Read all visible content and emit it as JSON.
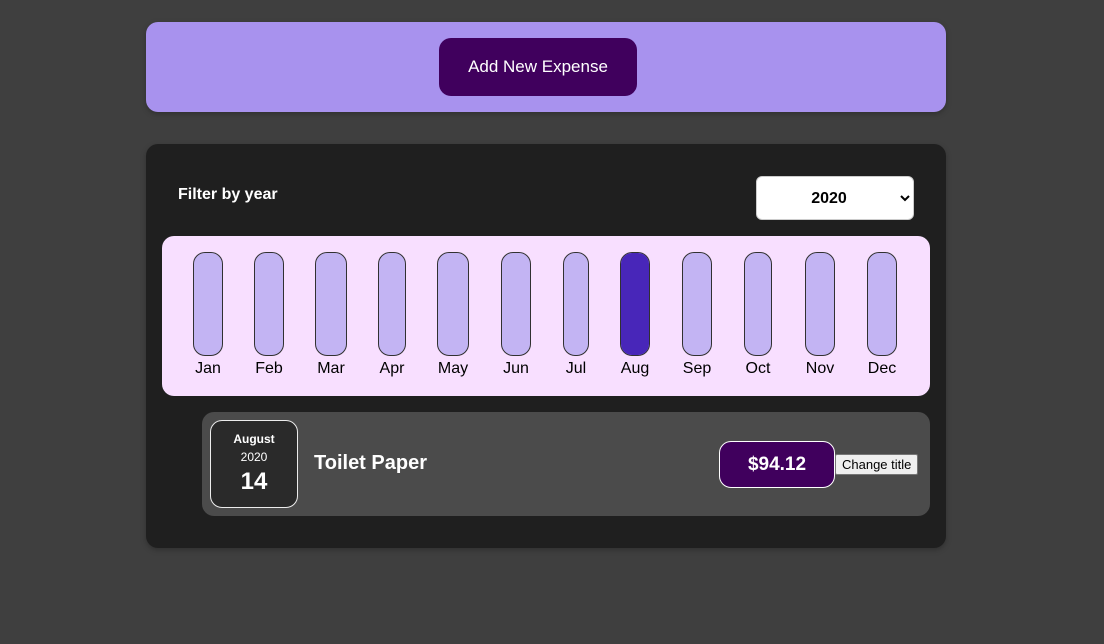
{
  "new_expense": {
    "button_label": "Add New Expense"
  },
  "filter": {
    "label": "Filter by year",
    "selected_year": "2020",
    "options": [
      "2020"
    ]
  },
  "chart_data": {
    "type": "bar",
    "categories": [
      "Jan",
      "Feb",
      "Mar",
      "Apr",
      "May",
      "Jun",
      "Jul",
      "Aug",
      "Sep",
      "Oct",
      "Nov",
      "Dec"
    ],
    "values": [
      0,
      0,
      0,
      0,
      0,
      0,
      0,
      94.12,
      0,
      0,
      0,
      0
    ],
    "ylim": [
      0,
      94.12
    ]
  },
  "expenses": [
    {
      "month": "August",
      "year": "2020",
      "day": "14",
      "title": "Toilet Paper",
      "amount": "$94.12",
      "change_title_label": "Change title"
    }
  ],
  "colors": {
    "background": "#3f3f3f",
    "new_expense_panel": "#a892ee",
    "accent_dark": "#40005d",
    "chart_background": "#f8dfff",
    "bar_empty": "#c3b4f3",
    "bar_fill": "#4826b9",
    "expenses_panel": "#1f1f1f",
    "expense_item": "#4b4b4b"
  }
}
